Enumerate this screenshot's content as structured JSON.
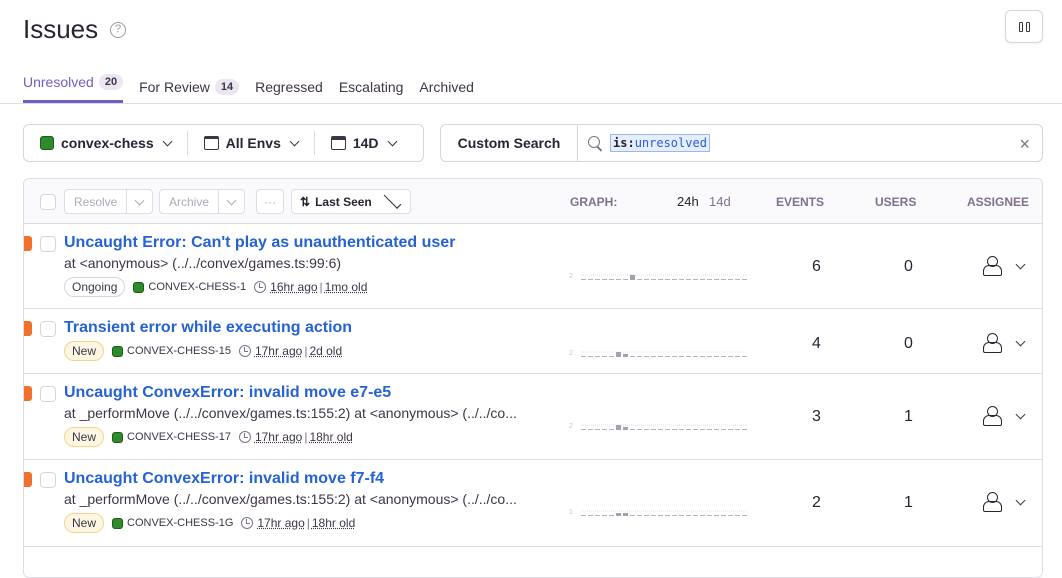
{
  "header": {
    "title": "Issues",
    "help_icon": "?"
  },
  "tabs": [
    {
      "label": "Unresolved",
      "count": "20"
    },
    {
      "label": "For Review",
      "count": "14"
    },
    {
      "label": "Regressed"
    },
    {
      "label": "Escalating"
    },
    {
      "label": "Archived"
    }
  ],
  "filters": {
    "project": "convex-chess",
    "env": "All Envs",
    "period": "14D"
  },
  "search": {
    "button": "Custom Search",
    "key": "is:",
    "value": "unresolved",
    "clear": "×"
  },
  "toolbar": {
    "resolve": "Resolve",
    "archive": "Archive",
    "more": "···",
    "sort": "Last Seen",
    "sort_icon": "⇅"
  },
  "columns": {
    "graph": "GRAPH:",
    "g24": "24h",
    "g14": "14d",
    "events": "EVENTS",
    "users": "USERS",
    "assignee": "ASSIGNEE"
  },
  "issues": [
    {
      "title": "Uncaught Error: Can't play as unauthenticated user",
      "subtitle": "at <anonymous> (../../convex/games.ts:99:6)",
      "status": "Ongoing",
      "project": "CONVEX-CHESS-1",
      "last_seen": "16hr ago",
      "age": "1mo old",
      "events": "6",
      "users": "0",
      "graph_max": "2",
      "graph": [
        0,
        0,
        0,
        0,
        0,
        0,
        0,
        1,
        0,
        0,
        0,
        0,
        0,
        0,
        0,
        0,
        0,
        0,
        0,
        0,
        0,
        0,
        0,
        0
      ]
    },
    {
      "title": "Transient error while executing action",
      "subtitle": "",
      "status": "New",
      "project": "CONVEX-CHESS-15",
      "last_seen": "17hr ago",
      "age": "2d old",
      "events": "4",
      "users": "0",
      "graph_max": "2",
      "graph": [
        0,
        0,
        0,
        0,
        0,
        1,
        0.5,
        0,
        0,
        0,
        0,
        0,
        0,
        0,
        0,
        0,
        0,
        0,
        0,
        0,
        0,
        0,
        0,
        0
      ]
    },
    {
      "title": "Uncaught ConvexError: invalid move e7-e5",
      "subtitle": "at _performMove (../../convex/games.ts:155:2) at <anonymous> (../../co...",
      "status": "New",
      "project": "CONVEX-CHESS-17",
      "last_seen": "17hr ago",
      "age": "18hr old",
      "events": "3",
      "users": "1",
      "graph_max": "2",
      "graph": [
        0,
        0,
        0,
        0,
        0,
        1,
        0.5,
        0,
        0,
        0,
        0,
        0,
        0,
        0,
        0,
        0,
        0,
        0,
        0,
        0,
        0,
        0,
        0,
        0
      ]
    },
    {
      "title": "Uncaught ConvexError: invalid move f7-f4",
      "subtitle": "at _performMove (../../convex/games.ts:155:2) at <anonymous> (../../co...",
      "status": "New",
      "project": "CONVEX-CHESS-1G",
      "last_seen": "17hr ago",
      "age": "18hr old",
      "events": "2",
      "users": "1",
      "graph_max": "1",
      "graph": [
        0,
        0,
        0,
        0,
        0,
        0.5,
        0.5,
        0,
        0,
        0,
        0,
        0,
        0,
        0,
        0,
        0,
        0,
        0,
        0,
        0,
        0,
        0,
        0,
        0
      ]
    }
  ],
  "colors": {
    "accent": "#6c5fc7",
    "link": "#2562d4",
    "flag": "#f0702d"
  }
}
